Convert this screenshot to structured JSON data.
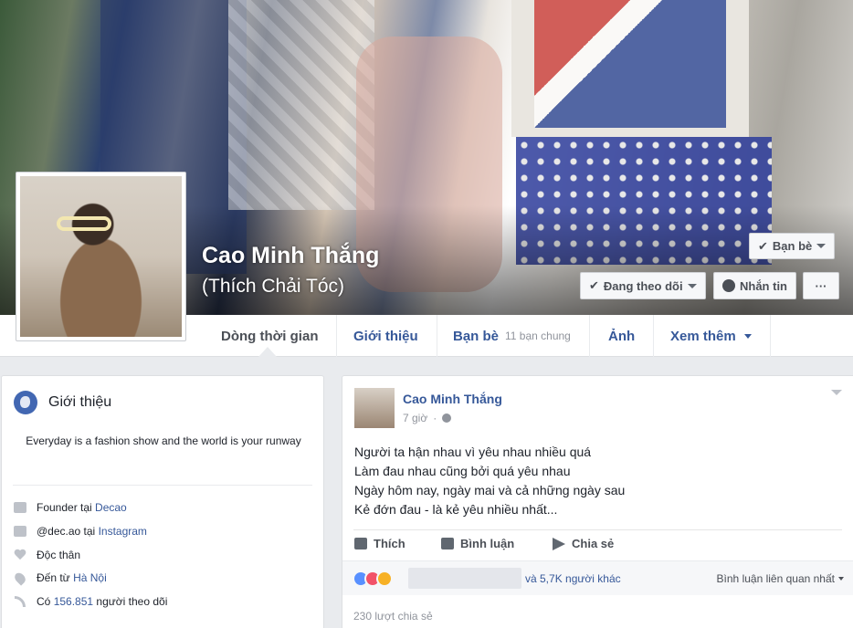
{
  "profile": {
    "name": "Cao Minh Thắng",
    "alternate_name": "(Thích Chải Tóc)"
  },
  "cover_buttons": {
    "friends": "Bạn bè",
    "following": "Đang theo dõi",
    "message": "Nhắn tin",
    "more": "···"
  },
  "nav": {
    "timeline": "Dòng thời gian",
    "about": "Giới thiệu",
    "friends": "Bạn bè",
    "mutual": "11 bạn chung",
    "photos": "Ảnh",
    "more": "Xem thêm"
  },
  "intro": {
    "title": "Giới thiệu",
    "bio": "Everyday is a fashion show and the world is your runway",
    "rows": [
      {
        "prefix": "Founder tại ",
        "link": "Decao",
        "suffix": ""
      },
      {
        "prefix": "@dec.ao tại ",
        "link": "Instagram",
        "suffix": ""
      },
      {
        "prefix": "Độc thân",
        "link": "",
        "suffix": ""
      },
      {
        "prefix": "Đến từ ",
        "link": "Hà Nội",
        "suffix": ""
      },
      {
        "prefix": "Có ",
        "link": "156.851",
        "suffix": " người theo dõi"
      }
    ]
  },
  "post": {
    "author": "Cao Minh Thắng",
    "time": "7 giờ",
    "lines": [
      "Người ta hận nhau vì yêu nhau nhiều quá",
      "Làm đau nhau cũng bởi quá yêu nhau",
      "Ngày hôm nay, ngày mai và cả những ngày sau",
      "Kẻ đớn đau - là kẻ yêu nhiều nhất..."
    ],
    "like": "Thích",
    "comment": "Bình luận",
    "share": "Chia sẻ",
    "others": "và 5,7K người khác",
    "comment_sort": "Bình luận liên quan nhất",
    "shares_count": "230 lượt chia sẻ"
  }
}
